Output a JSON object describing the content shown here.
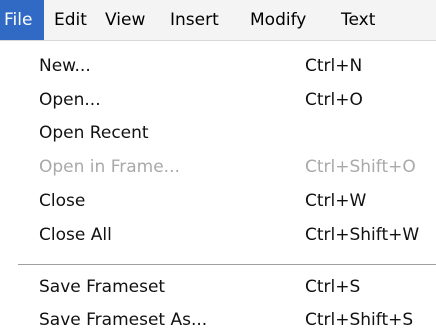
{
  "menubar": {
    "items": [
      {
        "label": "File",
        "active": true
      },
      {
        "label": "Edit",
        "active": false
      },
      {
        "label": "View",
        "active": false
      },
      {
        "label": "Insert",
        "active": false
      },
      {
        "label": "Modify",
        "active": false
      },
      {
        "label": "Text",
        "active": false
      }
    ]
  },
  "file_menu": {
    "items": [
      {
        "label": "New...",
        "shortcut": "Ctrl+N",
        "enabled": true
      },
      {
        "label": "Open...",
        "shortcut": "Ctrl+O",
        "enabled": true
      },
      {
        "label": "Open Recent",
        "shortcut": "",
        "enabled": true
      },
      {
        "label": "Open in Frame...",
        "shortcut": "Ctrl+Shift+O",
        "enabled": false
      },
      {
        "label": "Close",
        "shortcut": "Ctrl+W",
        "enabled": true
      },
      {
        "label": "Close All",
        "shortcut": "Ctrl+Shift+W",
        "enabled": true
      },
      {
        "label": "Save Frameset",
        "shortcut": "Ctrl+S",
        "enabled": true
      },
      {
        "label": "Save Frameset As...",
        "shortcut": "Ctrl+Shift+S",
        "enabled": true
      }
    ]
  },
  "colors": {
    "menubar_background": "#f4f4f4",
    "active_highlight": "#316ac5",
    "active_text": "#ffffff",
    "disabled_text": "#a9a9a9"
  }
}
